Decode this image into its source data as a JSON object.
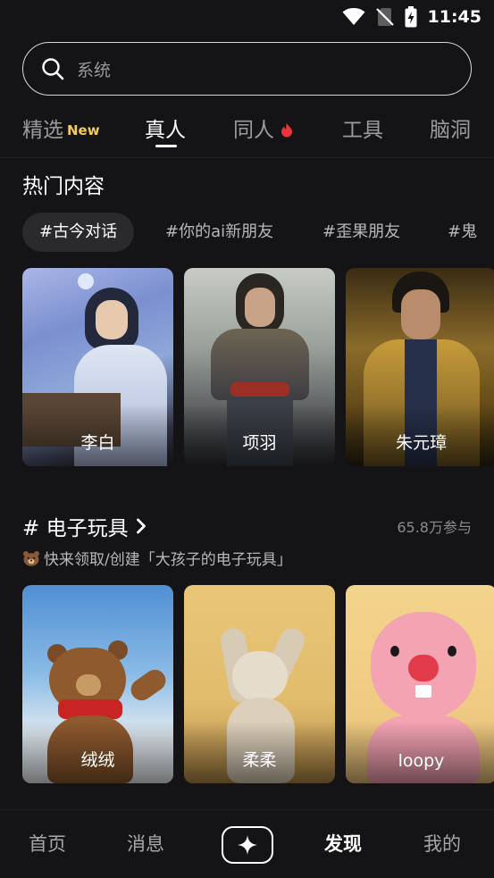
{
  "status_bar": {
    "time": "11:45",
    "icons": [
      "wifi-icon",
      "no-sim-icon",
      "battery-charging-icon"
    ]
  },
  "search": {
    "placeholder": "系统",
    "icon": "search-icon"
  },
  "tabs": [
    {
      "label": "精选",
      "badge": "New"
    },
    {
      "label": "真人",
      "active": true
    },
    {
      "label": "同人",
      "icon": "flame-icon"
    },
    {
      "label": "工具"
    },
    {
      "label": "脑洞"
    }
  ],
  "hot": {
    "title": "热门内容",
    "chips": [
      "#古今对话",
      "#你的ai新朋友",
      "#歪果朋友",
      "#鬼"
    ],
    "cards": [
      {
        "label": "李白"
      },
      {
        "label": "项羽"
      },
      {
        "label": "朱元璋"
      }
    ]
  },
  "topic": {
    "title": "# 电子玩具",
    "count": "65.8万参与",
    "description": "快来领取/创建「大孩子的电子玩具」",
    "cards": [
      {
        "label": "绒绒"
      },
      {
        "label": "柔柔"
      },
      {
        "label": "loopy"
      }
    ]
  },
  "bottom_nav": [
    {
      "label": "首页"
    },
    {
      "label": "消息"
    },
    {
      "icon": "sparkle-icon"
    },
    {
      "label": "发现",
      "active": true
    },
    {
      "label": "我的"
    }
  ],
  "colors": {
    "background": "#141416",
    "badge_new": "#f3cd5b",
    "flame": "#e8343d"
  }
}
